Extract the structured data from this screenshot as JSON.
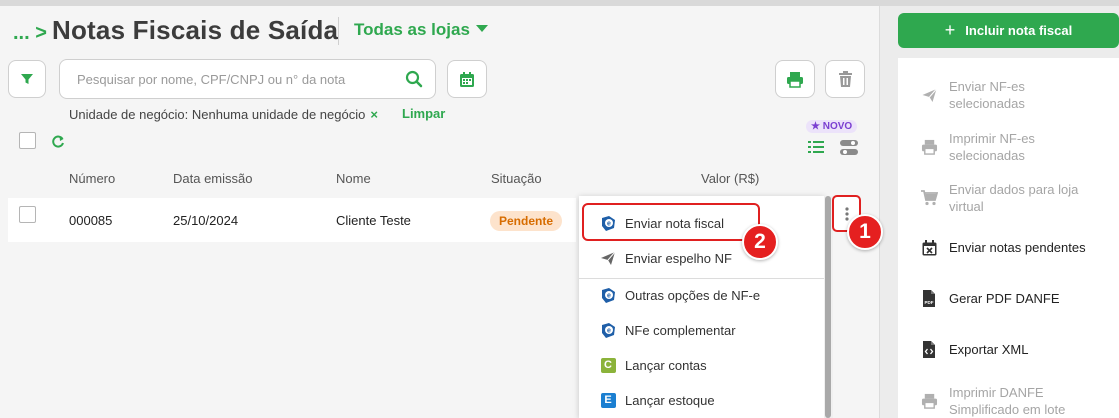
{
  "header": {
    "breadcrumb": "...",
    "breadcrumb_chevron": ">",
    "title": "Notas Fiscais de Saída",
    "store_selector": "Todas as lojas"
  },
  "search": {
    "placeholder": "Pesquisar por nome, CPF/CNPJ ou n° da nota",
    "value": ""
  },
  "filters": {
    "active_filter": "Unidade de negócio: Nenhuma unidade de negócio",
    "remove_label": "×",
    "clear_label": "Limpar"
  },
  "view": {
    "new_badge": "NOVO"
  },
  "table": {
    "columns": [
      "Número",
      "Data emissão",
      "Nome",
      "Situação",
      "Valor (R$)"
    ],
    "rows": [
      {
        "numero": "000085",
        "data": "25/10/2024",
        "nome": "Cliente Teste",
        "situacao": "Pendente"
      }
    ]
  },
  "dropdown": {
    "items": [
      {
        "label": "Enviar nota fiscal",
        "icon": "nfe-icon"
      },
      {
        "label": "Enviar espelho NF",
        "icon": "paper-plane-icon"
      },
      {
        "label": "Outras opções de NF-e",
        "icon": "nfe-icon"
      },
      {
        "label": "NFe complementar",
        "icon": "nfe-icon"
      },
      {
        "label": "Lançar contas",
        "icon": "contas-icon",
        "letter": "C"
      },
      {
        "label": "Lançar estoque",
        "icon": "estoque-icon",
        "letter": "E"
      }
    ]
  },
  "annotations": {
    "step1": "1",
    "step2": "2"
  },
  "sidebar": {
    "primary_button": "Incluir nota fiscal",
    "primary_plus": "+",
    "items": [
      {
        "label": "Enviar NF-es selecionadas",
        "icon": "paper-plane-icon",
        "enabled": false
      },
      {
        "label": "Imprimir NF-es selecionadas",
        "icon": "printer-icon",
        "enabled": false
      },
      {
        "label": "Enviar dados para loja virtual",
        "icon": "cart-icon",
        "enabled": false
      },
      {
        "label": "Enviar notas pendentes",
        "icon": "calendar-x-icon",
        "enabled": true
      },
      {
        "label": "Gerar PDF DANFE",
        "icon": "pdf-file-icon",
        "enabled": true
      },
      {
        "label": "Exportar XML",
        "icon": "code-file-icon",
        "enabled": true
      },
      {
        "label": "Imprimir DANFE Simplificado em lote",
        "icon": "printer-icon",
        "enabled": false
      }
    ]
  },
  "colors": {
    "brand_green": "#2fa84f",
    "status_pending_bg": "#fde3cc",
    "status_pending_text": "#d76c00",
    "annotation_red": "#e52020",
    "new_badge_purple": "#7a3fd1"
  }
}
